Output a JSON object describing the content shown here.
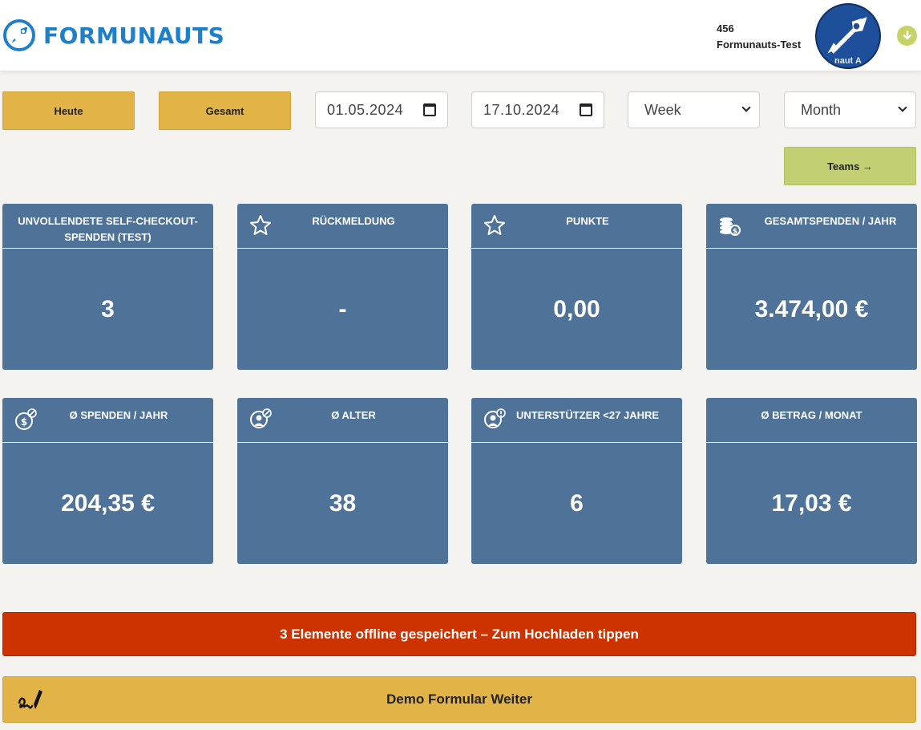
{
  "header": {
    "brand": "FORMUNAUTS",
    "user_id": "456",
    "user_name": "Formunauts-Test",
    "avatar_caption": "naut A",
    "brand_color": "#1f80c9"
  },
  "toolbar": {
    "today_label": "Heute",
    "total_label": "Gesamt",
    "start_date": "01.05.2024",
    "end_date": "17.10.2024",
    "period_select_1": "Week",
    "period_select_2": "Month",
    "teams_label": "Teams →"
  },
  "cards": [
    {
      "title": "UNVOLLENDETE SELF-CHECKOUT-SPENDEN (TEST)",
      "value": "3",
      "icon": "none"
    },
    {
      "title": "RÜCKMELDUNG",
      "value": "-",
      "icon": "star-icon"
    },
    {
      "title": "PUNKTE",
      "value": "0,00",
      "icon": "star-icon"
    },
    {
      "title": "GESAMTSPENDEN / JAHR",
      "value": "3.474,00 €",
      "icon": "coins-icon"
    },
    {
      "title": "Ø SPENDEN / JAHR",
      "value": "204,35 €",
      "icon": "coin-average-icon"
    },
    {
      "title": "Ø ALTER",
      "value": "38",
      "icon": "person-average-icon"
    },
    {
      "title": "UNTERSTÜTZER <27 JAHRE",
      "value": "6",
      "icon": "person-alert-icon"
    },
    {
      "title": "Ø BETRAG / MONAT",
      "value": "17,03 €",
      "icon": "none"
    }
  ],
  "offline_banner": "3 Elemente offline gespeichert – Zum Hochladen tippen",
  "demo_button": "Demo Formular Weiter",
  "colors": {
    "card_bg": "#4f7298",
    "button_yellow": "#e2b447",
    "button_green": "#c4cf73",
    "alert_red": "#cc3300"
  }
}
